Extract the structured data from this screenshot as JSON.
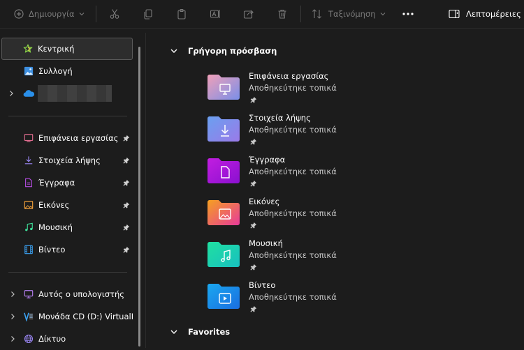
{
  "toolbar": {
    "new_label": "Δημιουργία",
    "sort_label": "Ταξινόμηση",
    "details_label": "Λεπτομέρειες"
  },
  "sidebar": {
    "top_items": [
      {
        "label": "Κεντρική",
        "icon": "home-star-icon",
        "selected": true
      },
      {
        "label": "Συλλογή",
        "icon": "gallery-icon"
      },
      {
        "label": "",
        "icon": "onedrive-cloud-icon",
        "redacted": true
      }
    ],
    "pinned": [
      {
        "label": "Επιφάνεια εργασίας",
        "icon": "desktop-icon"
      },
      {
        "label": "Στοιχεία λήψης",
        "icon": "downloads-icon"
      },
      {
        "label": "Έγγραφα",
        "icon": "documents-icon"
      },
      {
        "label": "Εικόνες",
        "icon": "pictures-icon"
      },
      {
        "label": "Μουσική",
        "icon": "music-icon"
      },
      {
        "label": "Βίντεο",
        "icon": "videos-icon"
      }
    ],
    "devices": [
      {
        "label": "Αυτός ο υπολογιστής",
        "icon": "this-pc-icon"
      },
      {
        "label": "Μονάδα CD (D:) VirtualBo",
        "icon": "cd-drive-icon"
      },
      {
        "label": "Δίκτυο",
        "icon": "network-icon"
      }
    ]
  },
  "main": {
    "quick_access_title": "Γρήγορη πρόσβαση",
    "favorites_title": "Favorites",
    "tiles": [
      {
        "name": "Επιφάνεια εργασίας",
        "subtitle": "Αποθηκεύτηκε τοπικά",
        "icon": "desktop-folder-icon"
      },
      {
        "name": "Στοιχεία λήψης",
        "subtitle": "Αποθηκεύτηκε τοπικά",
        "icon": "downloads-folder-icon"
      },
      {
        "name": "Έγγραφα",
        "subtitle": "Αποθηκεύτηκε τοπικά",
        "icon": "documents-folder-icon"
      },
      {
        "name": "Εικόνες",
        "subtitle": "Αποθηκεύτηκε τοπικά",
        "icon": "pictures-folder-icon"
      },
      {
        "name": "Μουσική",
        "subtitle": "Αποθηκεύτηκε τοπικά",
        "icon": "music-folder-icon"
      },
      {
        "name": "Βίντεο",
        "subtitle": "Αποθηκεύτηκε τοπικά",
        "icon": "videos-folder-icon"
      }
    ]
  },
  "colors": {
    "background": "#1c1c1c",
    "selected_item": "#2d2d2d",
    "folder_desktop": "#d9739a",
    "folder_downloads": "#4f80d6",
    "folder_documents": "#b017d8",
    "folder_pictures": "#f07a1e",
    "folder_music": "#1fcfa9",
    "folder_videos": "#1e8fe6"
  }
}
